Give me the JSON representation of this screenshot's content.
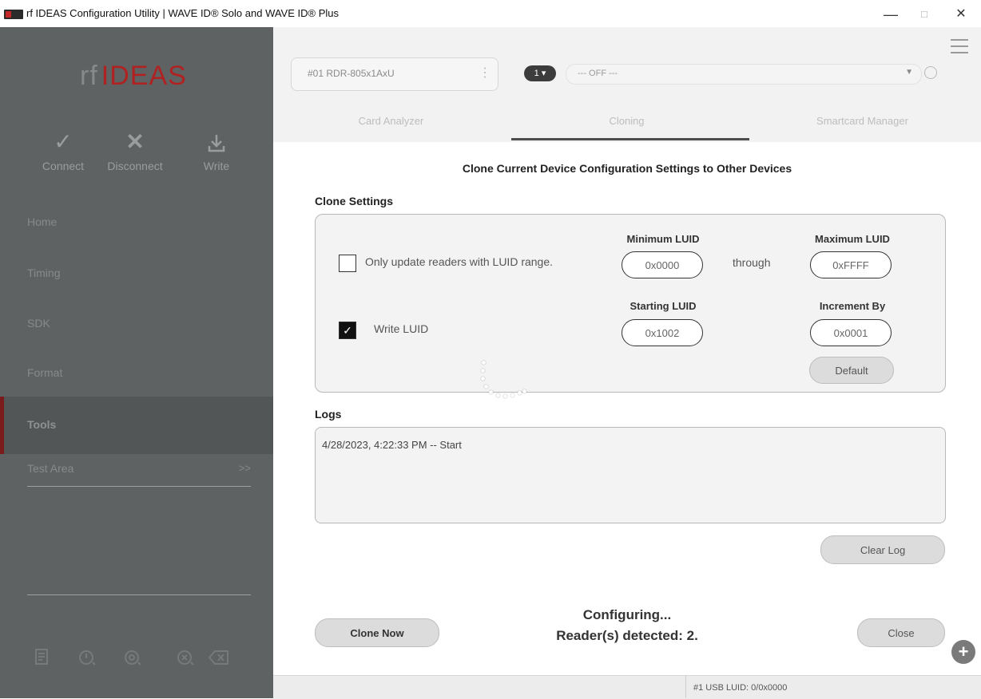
{
  "window": {
    "title": "rf IDEAS Configuration Utility | WAVE ID® Solo and WAVE ID® Plus",
    "minimize": "—",
    "maximize": "□",
    "close": "✕"
  },
  "sidebar": {
    "logo": {
      "rf": "rf",
      "ideas": "IDEAS"
    },
    "actions": [
      {
        "label": "Connect",
        "icon": "check-icon"
      },
      {
        "label": "Disconnect",
        "icon": "x-icon"
      },
      {
        "label": "Write",
        "icon": "download-icon"
      }
    ],
    "nav": [
      {
        "label": "Home"
      },
      {
        "label": "Timing"
      },
      {
        "label": "SDK"
      },
      {
        "label": "Format"
      },
      {
        "label": "Tools"
      }
    ],
    "test_area": {
      "label": "Test Area",
      "chevron": ">>"
    }
  },
  "header": {
    "device": "#01 RDR-805x1AxU",
    "badge": "1",
    "mode": "--- OFF ---",
    "tabs": [
      "Card Analyzer",
      "Cloning",
      "Smartcard Manager"
    ],
    "active_tab": "Cloning"
  },
  "main": {
    "heading": "Clone Current Device Configuration Settings to Other Devices",
    "clone_settings_label": "Clone Settings",
    "only_update_label": "Only update readers with LUID range.",
    "only_update_checked": false,
    "write_luid_label": "Write LUID",
    "write_luid_checked": true,
    "min_luid_label": "Minimum LUID",
    "min_luid_value": "0x0000",
    "through_label": "through",
    "max_luid_label": "Maximum LUID",
    "max_luid_value": "0xFFFF",
    "starting_luid_label": "Starting LUID",
    "starting_luid_value": "0x1002",
    "increment_label": "Increment By",
    "increment_value": "0x0001",
    "default_button": "Default",
    "logs_label": "Logs",
    "log_entries": [
      "4/28/2023, 4:22:33 PM -- Start"
    ],
    "clear_log_button": "Clear Log",
    "clone_now_button": "Clone Now",
    "status_line1": "Configuring...",
    "status_line2": "Reader(s) detected: 2.",
    "close_button": "Close"
  },
  "statusbar": {
    "text": "#1 USB LUID: 0/0x0000"
  }
}
